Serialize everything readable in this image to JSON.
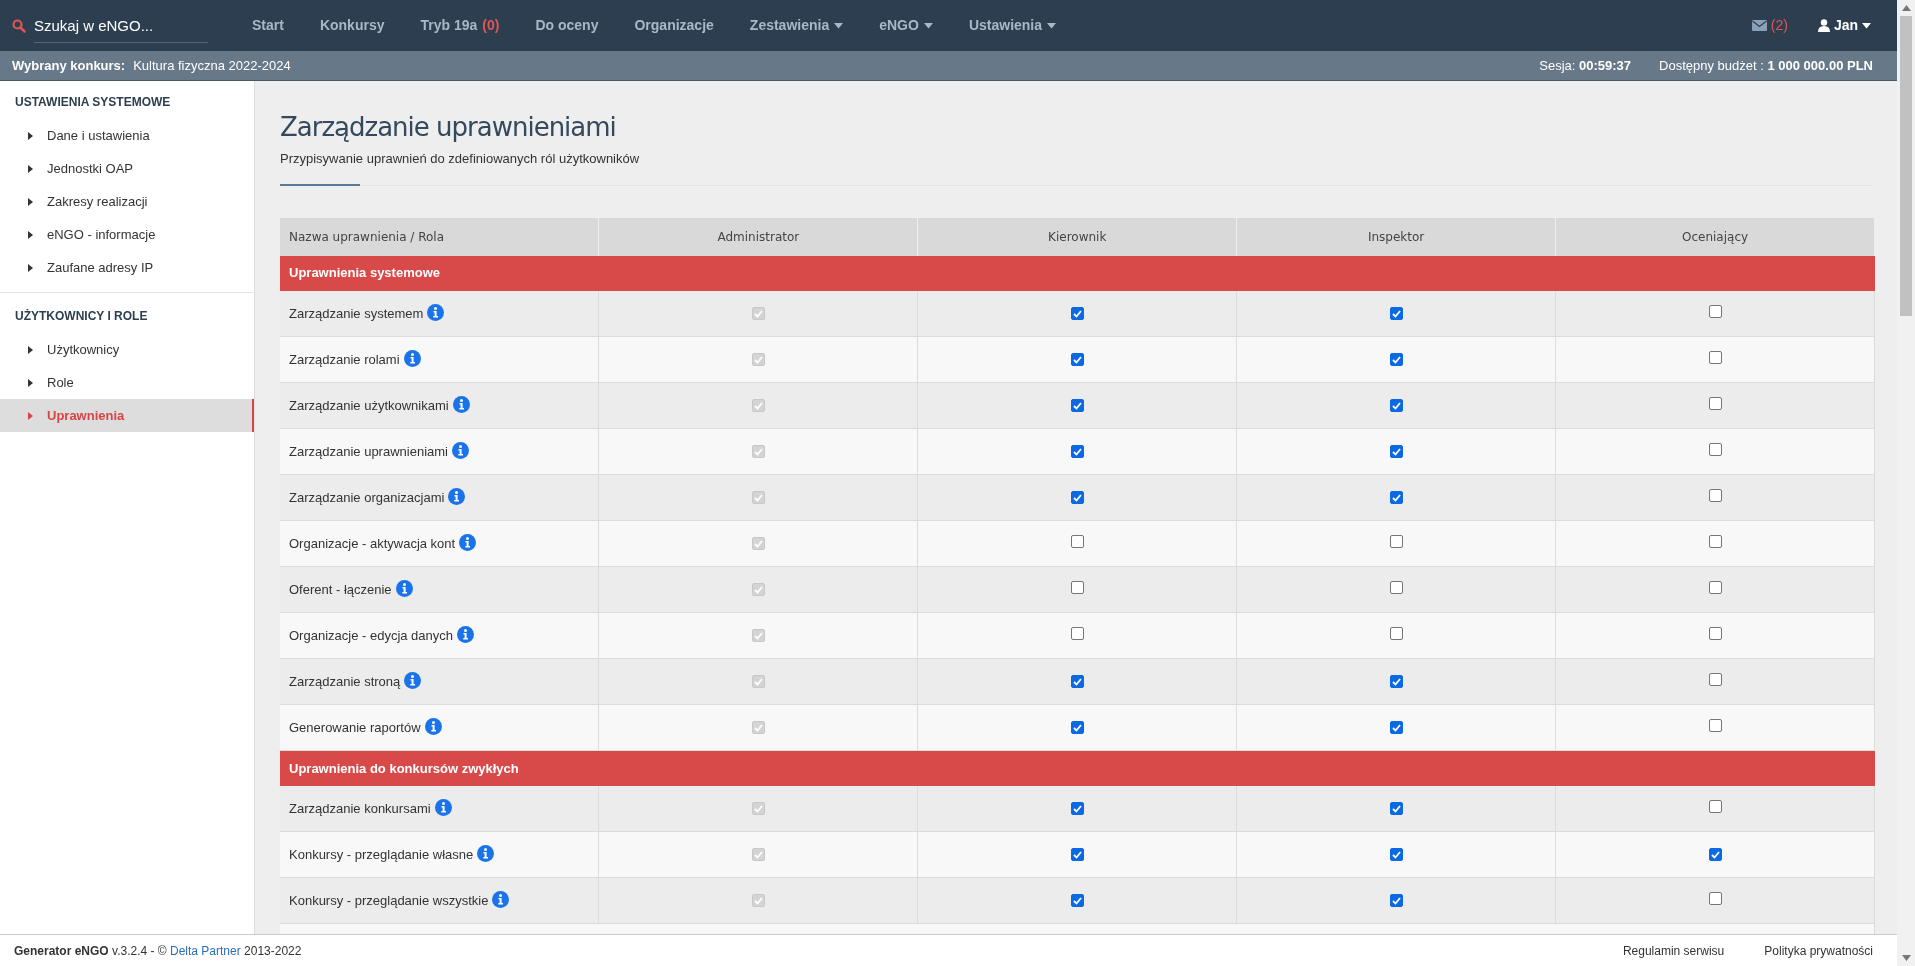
{
  "search": {
    "placeholder": "Szukaj w eNGO..."
  },
  "nav": [
    {
      "label": "Start",
      "dropdown": false
    },
    {
      "label": "Konkursy",
      "dropdown": false
    },
    {
      "label": "Tryb 19a",
      "count": "(0)",
      "dropdown": false
    },
    {
      "label": "Do oceny",
      "dropdown": false
    },
    {
      "label": "Organizacje",
      "dropdown": false
    },
    {
      "label": "Zestawienia",
      "dropdown": true
    },
    {
      "label": "eNGO",
      "dropdown": true
    },
    {
      "label": "Ustawienia",
      "dropdown": true
    }
  ],
  "messages": {
    "count": "(2)"
  },
  "user": {
    "name": "Jan"
  },
  "context_bar": {
    "label": "Wybrany konkurs:",
    "value": "Kultura fizyczna 2022-2024",
    "session_label": "Sesja:",
    "session": "00:59:37",
    "budget_label": "Dostępny budżet :",
    "budget": "1 000 000.00 PLN"
  },
  "sidebar": [
    {
      "title": "USTAWIENIA SYSTEMOWE",
      "items": [
        {
          "label": "Dane i ustawienia",
          "selected": false
        },
        {
          "label": "Jednostki OAP",
          "selected": false
        },
        {
          "label": "Zakresy realizacji",
          "selected": false
        },
        {
          "label": "eNGO - informacje",
          "selected": false
        },
        {
          "label": "Zaufane adresy IP",
          "selected": false
        }
      ]
    },
    {
      "title": "UŻYTKOWNICY I ROLE",
      "items": [
        {
          "label": "Użytkownicy",
          "selected": false
        },
        {
          "label": "Role",
          "selected": false
        },
        {
          "label": "Uprawnienia",
          "selected": true
        }
      ]
    }
  ],
  "page": {
    "title": "Zarządzanie uprawnieniami",
    "subtitle": "Przypisywanie uprawnień do zdefiniowanych ról użytkowników"
  },
  "table": {
    "columns": [
      "Nazwa uprawnienia / Rola",
      "Administrator",
      "Kierownik",
      "Inspektor",
      "Oceniający"
    ],
    "rows": [
      {
        "kind": "section",
        "label": "Uprawnienia systemowe"
      },
      {
        "kind": "permission",
        "label": "Zarządzanie systemem",
        "cells": [
          {
            "checked": true,
            "disabled": true
          },
          {
            "checked": true,
            "disabled": false
          },
          {
            "checked": true,
            "disabled": false
          },
          {
            "checked": false,
            "disabled": false
          }
        ]
      },
      {
        "kind": "permission",
        "label": "Zarządzanie rolami",
        "cells": [
          {
            "checked": true,
            "disabled": true
          },
          {
            "checked": true,
            "disabled": false
          },
          {
            "checked": true,
            "disabled": false
          },
          {
            "checked": false,
            "disabled": false
          }
        ]
      },
      {
        "kind": "permission",
        "label": "Zarządzanie użytkownikami",
        "cells": [
          {
            "checked": true,
            "disabled": true
          },
          {
            "checked": true,
            "disabled": false
          },
          {
            "checked": true,
            "disabled": false
          },
          {
            "checked": false,
            "disabled": false
          }
        ]
      },
      {
        "kind": "permission",
        "label": "Zarządzanie uprawnieniami",
        "cells": [
          {
            "checked": true,
            "disabled": true
          },
          {
            "checked": true,
            "disabled": false
          },
          {
            "checked": true,
            "disabled": false
          },
          {
            "checked": false,
            "disabled": false
          }
        ]
      },
      {
        "kind": "permission",
        "label": "Zarządzanie organizacjami",
        "cells": [
          {
            "checked": true,
            "disabled": true
          },
          {
            "checked": true,
            "disabled": false
          },
          {
            "checked": true,
            "disabled": false
          },
          {
            "checked": false,
            "disabled": false
          }
        ]
      },
      {
        "kind": "permission",
        "label": "Organizacje - aktywacja kont",
        "cells": [
          {
            "checked": true,
            "disabled": true
          },
          {
            "checked": false,
            "disabled": false
          },
          {
            "checked": false,
            "disabled": false
          },
          {
            "checked": false,
            "disabled": false
          }
        ]
      },
      {
        "kind": "permission",
        "label": "Oferent - łączenie",
        "cells": [
          {
            "checked": true,
            "disabled": true
          },
          {
            "checked": false,
            "disabled": false
          },
          {
            "checked": false,
            "disabled": false
          },
          {
            "checked": false,
            "disabled": false
          }
        ]
      },
      {
        "kind": "permission",
        "label": "Organizacje - edycja danych",
        "cells": [
          {
            "checked": true,
            "disabled": true
          },
          {
            "checked": false,
            "disabled": false
          },
          {
            "checked": false,
            "disabled": false
          },
          {
            "checked": false,
            "disabled": false
          }
        ]
      },
      {
        "kind": "permission",
        "label": "Zarządzanie stroną",
        "cells": [
          {
            "checked": true,
            "disabled": true
          },
          {
            "checked": true,
            "disabled": false
          },
          {
            "checked": true,
            "disabled": false
          },
          {
            "checked": false,
            "disabled": false
          }
        ]
      },
      {
        "kind": "permission",
        "label": "Generowanie raportów",
        "cells": [
          {
            "checked": true,
            "disabled": true
          },
          {
            "checked": true,
            "disabled": false
          },
          {
            "checked": true,
            "disabled": false
          },
          {
            "checked": false,
            "disabled": false
          }
        ]
      },
      {
        "kind": "section",
        "label": "Uprawnienia do konkursów zwykłych"
      },
      {
        "kind": "permission",
        "label": "Zarządzanie konkursami",
        "cells": [
          {
            "checked": true,
            "disabled": true
          },
          {
            "checked": true,
            "disabled": false
          },
          {
            "checked": true,
            "disabled": false
          },
          {
            "checked": false,
            "disabled": false
          }
        ]
      },
      {
        "kind": "permission",
        "label": "Konkursy - przeglądanie własne",
        "cells": [
          {
            "checked": true,
            "disabled": true
          },
          {
            "checked": true,
            "disabled": false
          },
          {
            "checked": true,
            "disabled": false
          },
          {
            "checked": true,
            "disabled": false
          }
        ]
      },
      {
        "kind": "permission",
        "label": "Konkursy - przeglądanie wszystkie",
        "cells": [
          {
            "checked": true,
            "disabled": true
          },
          {
            "checked": true,
            "disabled": false
          },
          {
            "checked": true,
            "disabled": false
          },
          {
            "checked": false,
            "disabled": false
          }
        ]
      }
    ]
  },
  "footer": {
    "product": "Generator eNGO",
    "version": "v.3.2.4 - ©",
    "company": "Delta Partner",
    "years": "2013-2022",
    "links": [
      "Regulamin serwisu",
      "Polityka prywatności"
    ]
  }
}
